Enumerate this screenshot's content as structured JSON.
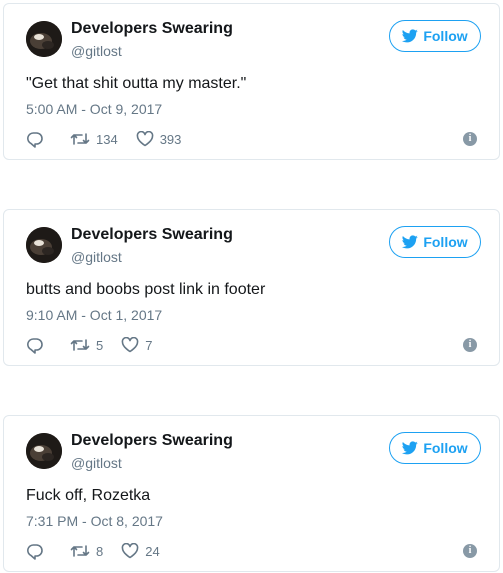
{
  "tweets": [
    {
      "name": "Developers Swearing",
      "handle": "@gitlost",
      "follow_label": "Follow",
      "text": "\"Get that shit outta my master.\"",
      "time": "5:00 AM - Oct 9, 2017",
      "retweets": "134",
      "likes": "393"
    },
    {
      "name": "Developers Swearing",
      "handle": "@gitlost",
      "follow_label": "Follow",
      "text": "butts and boobs post link in footer",
      "time": "9:10 AM - Oct 1, 2017",
      "retweets": "5",
      "likes": "7"
    },
    {
      "name": "Developers Swearing",
      "handle": "@gitlost",
      "follow_label": "Follow",
      "text": "Fuck off, Rozetka",
      "time": "7:31 PM - Oct 8, 2017",
      "retweets": "8",
      "likes": "24"
    }
  ],
  "icons": {
    "avatar": "avatar-image",
    "follow": "twitter-bird-icon",
    "reply": "reply-icon",
    "retweet": "retweet-icon",
    "like": "heart-icon",
    "info": "info-icon"
  },
  "colors": {
    "accent": "#1da1f2",
    "muted": "#657786",
    "border": "#e1e8ed",
    "text": "#14171a"
  }
}
